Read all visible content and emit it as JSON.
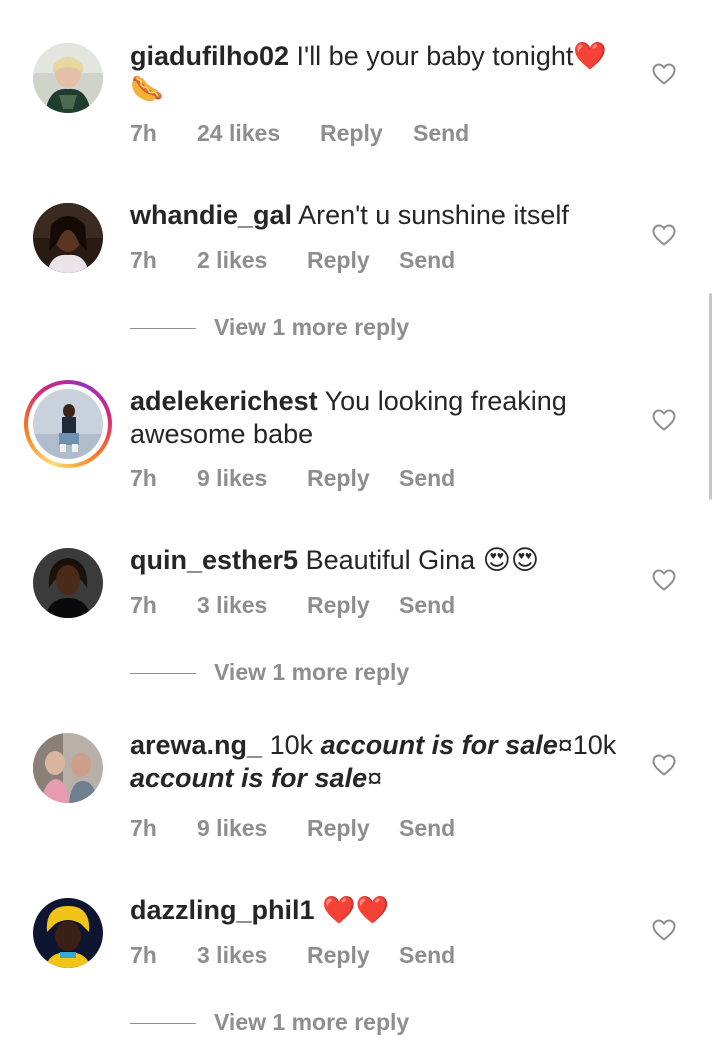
{
  "comments": [
    {
      "username": "giadufilho02",
      "text": "I'll be your baby tonight",
      "emoji": "❤️🌭",
      "time": "7h",
      "likes": "24 likes",
      "reply": "Reply",
      "send": "Send"
    },
    {
      "username": "whandie_gal",
      "text": "Aren't u sunshine itself",
      "time": "7h",
      "likes": "2 likes",
      "reply": "Reply",
      "send": "Send",
      "view_more": "View 1 more reply"
    },
    {
      "username": "adelekerichest",
      "text": "You looking freaking awesome babe",
      "time": "7h",
      "likes": "9 likes",
      "reply": "Reply",
      "send": "Send"
    },
    {
      "username": "quin_esther5",
      "text": "Beautiful Gina",
      "emoji": "😍😍",
      "time": "7h",
      "likes": "3 likes",
      "reply": "Reply",
      "send": "Send",
      "view_more": "View 1 more reply"
    },
    {
      "username": "arewa.ng_",
      "text_prefix": "10k",
      "text_bold": "account is for sale",
      "text_mid": "¤10k",
      "text_bold2": "account is for sale",
      "text_end": "¤",
      "time": "7h",
      "likes": "9 likes",
      "reply": "Reply",
      "send": "Send"
    },
    {
      "username": "dazzling_phil1",
      "emoji": "❤️❤️",
      "time": "7h",
      "likes": "3 likes",
      "reply": "Reply",
      "send": "Send",
      "view_more": "View 1 more reply"
    }
  ]
}
